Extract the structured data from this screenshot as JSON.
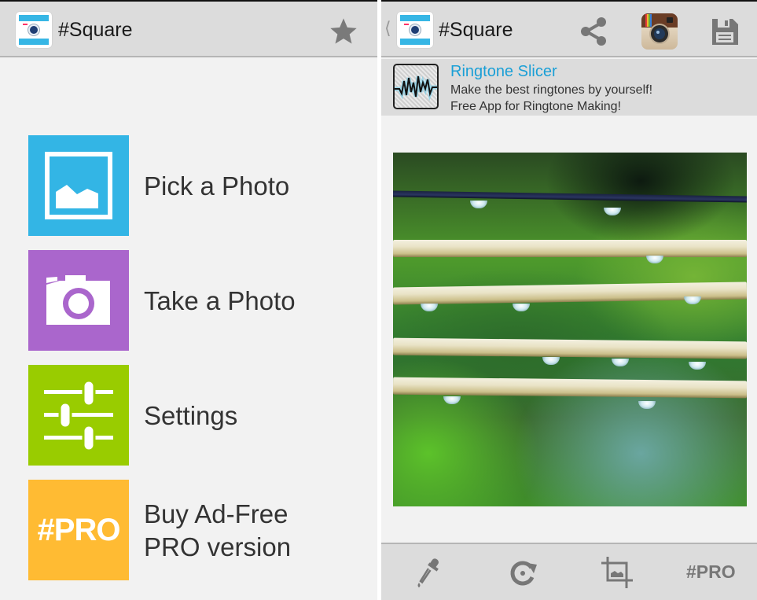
{
  "left_screen": {
    "app_title": "#Square",
    "menu": [
      {
        "label": "Pick a Photo",
        "icon": "image-icon",
        "color": "#33b5e5"
      },
      {
        "label": "Take a Photo",
        "icon": "camera-icon",
        "color": "#aa66cc"
      },
      {
        "label": "Settings",
        "icon": "sliders-icon",
        "color": "#99cc00"
      },
      {
        "label": "Buy Ad-Free\nPRO version",
        "icon": "pro-badge",
        "tile_text": "#PRO",
        "color": "#ffbb33"
      }
    ]
  },
  "right_screen": {
    "app_title": "#Square",
    "ad": {
      "title": "Ringtone Slicer",
      "line1": "Make the best ringtones by yourself!",
      "line2": "Free App for Ringtone Making!"
    },
    "photo_description": "Raindrops on wires over green blurred background",
    "bottom_toolbar": {
      "pro_label": "#PRO"
    }
  },
  "colors": {
    "actionbar": "#dcdcdc",
    "background": "#f2f2f2",
    "ad_title": "#1a9fd6",
    "icon_gray": "#777777"
  }
}
